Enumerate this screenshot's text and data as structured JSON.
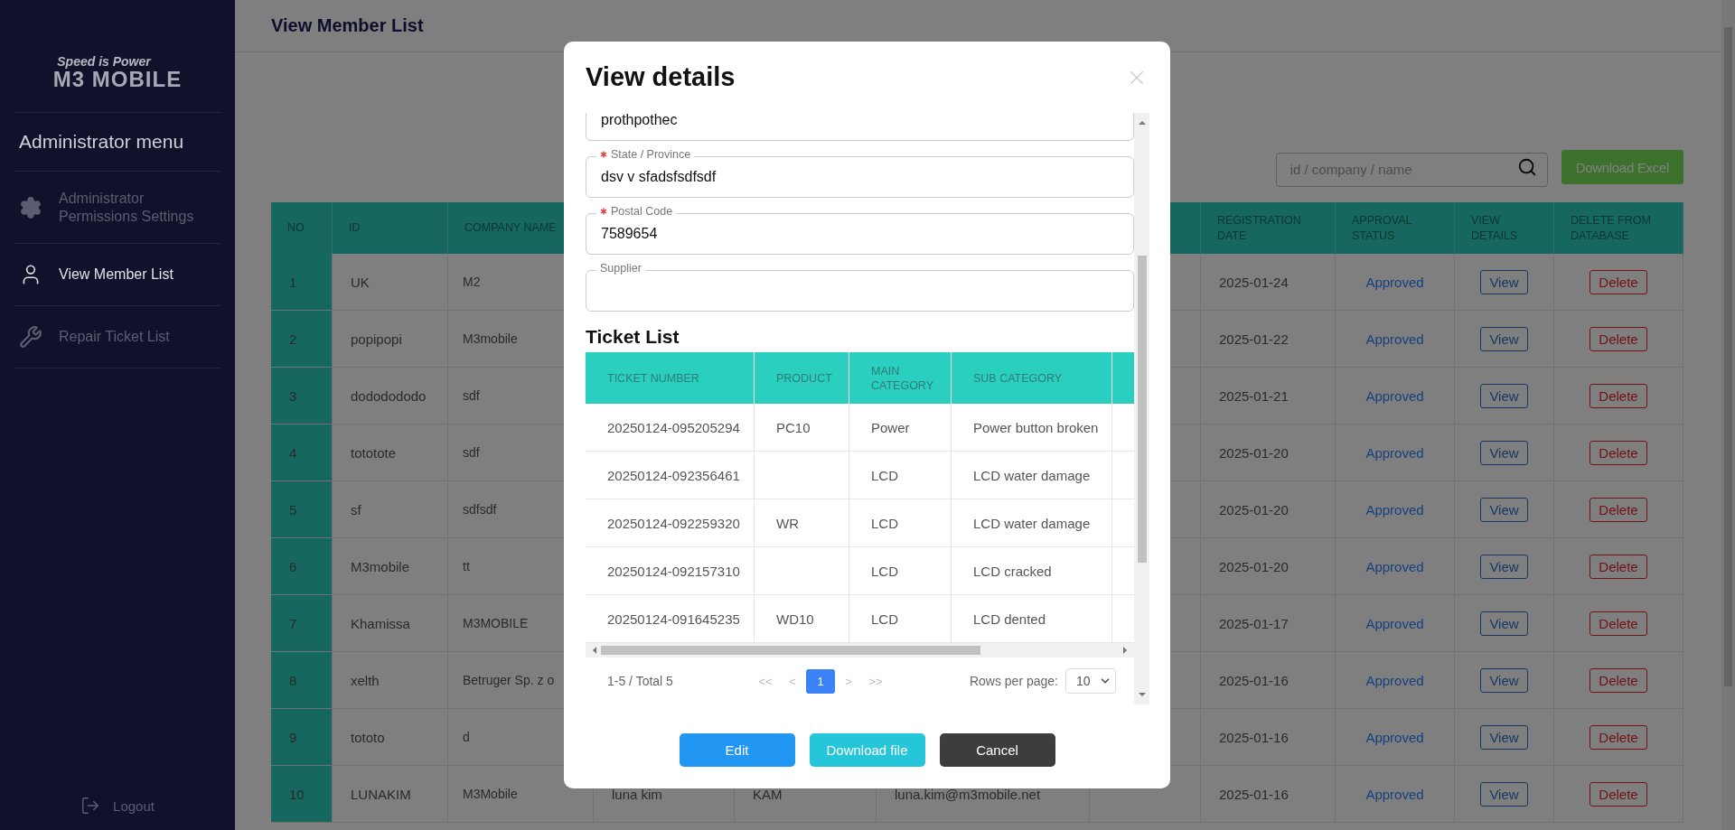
{
  "sidebar": {
    "logo_tagline": "Speed is Power",
    "logo": "M3 MOBILE",
    "menu_title": "Administrator menu",
    "items": [
      {
        "label": "Administrator Permissions Settings",
        "selected": false
      },
      {
        "label": "View Member List",
        "selected": true
      },
      {
        "label": "Repair Ticket List",
        "selected": false
      }
    ],
    "logout": "Logout"
  },
  "header": {
    "title": "View Member List"
  },
  "toolbar": {
    "search_placeholder": "id / company / name",
    "download_button": "Download Excel"
  },
  "member_table": {
    "columns": [
      "NO",
      "ID",
      "COMPANY NAME",
      "REGISTRATION DATE",
      "APPROVAL STATUS",
      "VIEW DETAILS",
      "DELETE FROM DATABASE"
    ],
    "rows": [
      {
        "no": "1",
        "id": "UK",
        "company": "M2",
        "registration_date": "2025-01-24",
        "status": "Approved",
        "view": "View",
        "delete": "Delete"
      },
      {
        "no": "2",
        "id": "popipopi",
        "company": "M3mobile",
        "registration_date": "2025-01-22",
        "status": "Approved",
        "view": "View",
        "delete": "Delete"
      },
      {
        "no": "3",
        "id": "dododododo",
        "company": "sdf",
        "registration_date": "2025-01-21",
        "status": "Approved",
        "view": "View",
        "delete": "Delete"
      },
      {
        "no": "4",
        "id": "tototote",
        "company": "sdf",
        "registration_date": "2025-01-20",
        "status": "Approved",
        "view": "View",
        "delete": "Delete"
      },
      {
        "no": "5",
        "id": "sf",
        "company": "sdfsdf",
        "registration_date": "2025-01-20",
        "status": "Approved",
        "view": "View",
        "delete": "Delete"
      },
      {
        "no": "6",
        "id": "M3mobile",
        "company": "tt",
        "registration_date": "2025-01-20",
        "status": "Approved",
        "view": "View",
        "delete": "Delete"
      },
      {
        "no": "7",
        "id": "Khamissa",
        "company": "M3MOBILE",
        "registration_date": "2025-01-17",
        "status": "Approved",
        "view": "View",
        "delete": "Delete"
      },
      {
        "no": "8",
        "id": "xelth",
        "company": "Betruger Sp. z o",
        "registration_date": "2025-01-16",
        "status": "Approved",
        "view": "View",
        "delete": "Delete"
      },
      {
        "no": "9",
        "id": "tototo",
        "company": "d",
        "registration_date": "2025-01-16",
        "status": "Approved",
        "view": "View",
        "delete": "Delete"
      },
      {
        "no": "10",
        "id": "LUNAKIM",
        "company": "M3Mobile",
        "column_4": "luna kim",
        "column_5": "KAM",
        "column_6": "luna.kim@m3mobile.net",
        "registration_date": "2025-01-16",
        "status": "Approved",
        "view": "View",
        "delete": "Delete"
      }
    ]
  },
  "modal": {
    "title": "View details",
    "fields": [
      {
        "value": "prothpothec"
      },
      {
        "label": "State / Province",
        "required": true,
        "value": "dsv v sfadsfsdfsdf"
      },
      {
        "label": "Postal Code",
        "required": true,
        "value": "7589654"
      },
      {
        "label": "Supplier",
        "required": false
      }
    ],
    "ticket_list": {
      "title": "Ticket List",
      "columns": [
        "TICKET NUMBER",
        "PRODUCT",
        "MAIN CATEGORY",
        "SUB CATEGORY"
      ],
      "rows": [
        [
          "20250124-095205294",
          "PC10",
          "Power",
          "Power button broken"
        ],
        [
          "20250124-092356461",
          null,
          "LCD",
          "LCD water damage"
        ],
        [
          "20250124-092259320",
          "WR",
          "LCD",
          "LCD water damage"
        ],
        [
          "20250124-092157310",
          null,
          "LCD",
          "LCD cracked"
        ],
        [
          "20250124-091645235",
          "WD10",
          "LCD",
          "LCD dented"
        ]
      ],
      "pagination": {
        "summary": "1-5 / Total 5",
        "first": "<<",
        "prev": "<",
        "pages": [
          {
            "label": "1",
            "selected": true
          }
        ],
        "next": ">",
        "last": ">>",
        "rows_per_page_label": "Rows per page:",
        "rows_per_page": "10"
      }
    },
    "buttons": [
      {
        "label": "Edit",
        "kind": "edit"
      },
      {
        "label": "Download file",
        "kind": "download"
      },
      {
        "label": "Cancel",
        "kind": "cancel"
      }
    ]
  }
}
